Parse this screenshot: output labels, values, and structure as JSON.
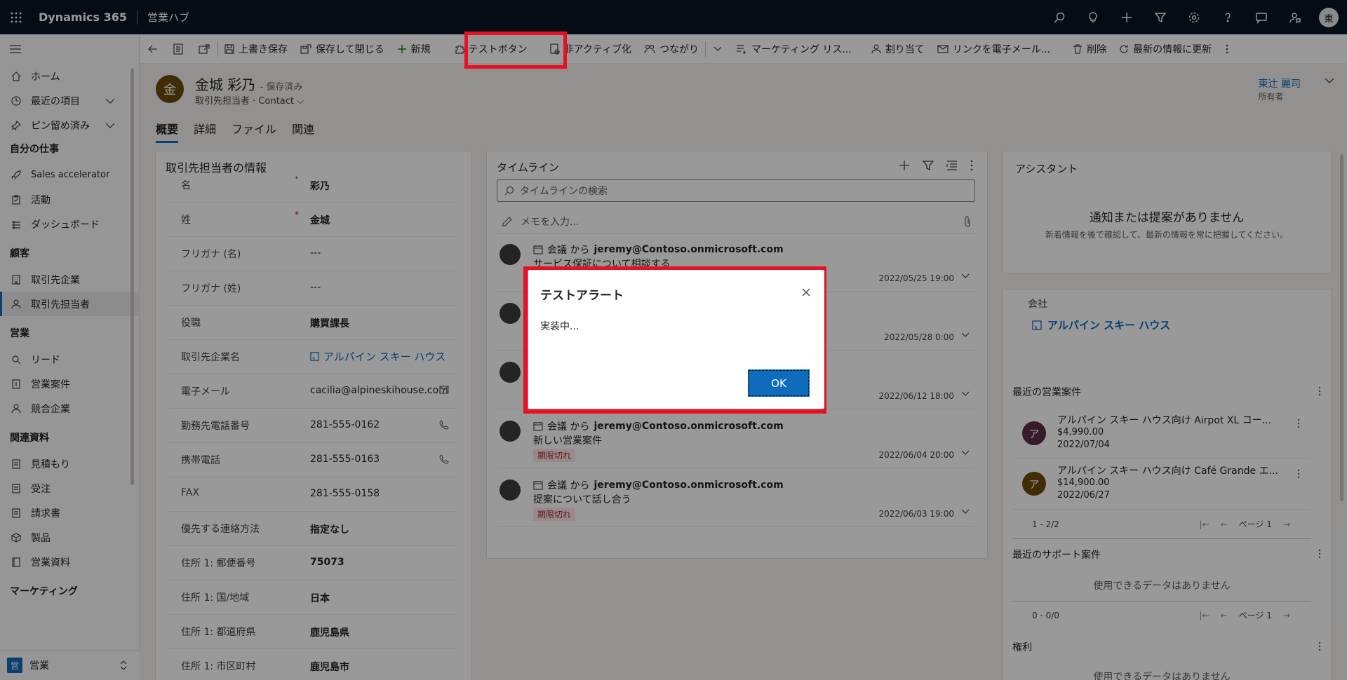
{
  "topbar": {
    "app_title": "Dynamics 365",
    "hub": "営業ハブ",
    "user_initial": "東"
  },
  "sidebar": {
    "items_top": [
      {
        "label": "ホーム",
        "icon": "home-icon"
      },
      {
        "label": "最近の項目",
        "icon": "clock-icon"
      },
      {
        "label": "ピン留め済み",
        "icon": "pin-icon"
      }
    ],
    "group_work": "自分の仕事",
    "items_work": [
      {
        "label": "Sales accelerator",
        "icon": "rocket-icon"
      },
      {
        "label": "活動",
        "icon": "clipboard-icon"
      },
      {
        "label": "ダッシュボード",
        "icon": "dashboard-icon"
      }
    ],
    "group_customer": "顧客",
    "items_customer": [
      {
        "label": "取引先企業",
        "icon": "building-icon"
      },
      {
        "label": "取引先担当者",
        "icon": "person-icon"
      }
    ],
    "group_sales": "営業",
    "items_sales": [
      {
        "label": "リード",
        "icon": "phone-person-icon"
      },
      {
        "label": "営業案件",
        "icon": "document-icon"
      },
      {
        "label": "競合企業",
        "icon": "person-icon"
      }
    ],
    "group_material": "関連資料",
    "items_material": [
      {
        "label": "見積もり",
        "icon": "document-icon"
      },
      {
        "label": "受注",
        "icon": "document-icon"
      },
      {
        "label": "請求書",
        "icon": "document-icon"
      },
      {
        "label": "製品",
        "icon": "box-icon"
      },
      {
        "label": "営業資料",
        "icon": "book-icon"
      }
    ],
    "group_marketing": "マーケティング",
    "area_badge": "営",
    "area_label": "営業"
  },
  "commandbar": {
    "save": "上書き保存",
    "save_close": "保存して閉じる",
    "new": "新規",
    "test_button": "テストボタン",
    "deactivate": "非アクティブ化",
    "connect": "つながり",
    "marketing_list": "マーケティング リス...",
    "assign": "割り当て",
    "email_link": "リンクを電子メール...",
    "delete": "削除",
    "refresh": "最新の情報に更新"
  },
  "record": {
    "avatar_initial": "金",
    "name": "金城 彩乃",
    "saved_status": "- 保存済み",
    "entity": "取引先担当者",
    "dot": "·",
    "form": "Contact",
    "owner_name": "東辻 麗司",
    "owner_label": "所有者"
  },
  "tabs": [
    "概要",
    "詳細",
    "ファイル",
    "関連"
  ],
  "contact_card": {
    "title": "取引先担当者の情報",
    "fields": [
      {
        "label": "名",
        "value": "彩乃"
      },
      {
        "label": "姓",
        "value": "金城"
      },
      {
        "label": "フリガナ (名)",
        "value": "---"
      },
      {
        "label": "フリガナ (姓)",
        "value": "---"
      },
      {
        "label": "役職",
        "value": "購買課長"
      },
      {
        "label": "取引先企業名",
        "value": "アルパイン スキー ハウス"
      },
      {
        "label": "電子メール",
        "value": "cacilia@alpineskihouse.com"
      },
      {
        "label": "勤務先電話番号",
        "value": "281-555-0162"
      },
      {
        "label": "携帯電話",
        "value": "281-555-0163"
      },
      {
        "label": "FAX",
        "value": "281-555-0158"
      },
      {
        "label": "優先する連絡方法",
        "value": "指定なし"
      },
      {
        "label": "住所 1: 郵便番号",
        "value": "75073"
      },
      {
        "label": "住所 1: 国/地域",
        "value": "日本"
      },
      {
        "label": "住所 1: 都道府県",
        "value": "鹿児島県"
      },
      {
        "label": "住所 1: 市区町村",
        "value": "鹿児島市"
      }
    ],
    "required_mark": "*"
  },
  "timeline": {
    "title": "タイムライン",
    "search_placeholder": "タイムラインの検索",
    "note_placeholder": "メモを入力...",
    "items": [
      {
        "prefix": "会議 から",
        "from": "jeremy@Contoso.onmicrosoft.com",
        "subject": "サービス保証について相談する",
        "tag": "",
        "date": "2022/05/25 19:00"
      },
      {
        "prefix": "",
        "from": "",
        "subject": "",
        "tag": "",
        "date": "2022/05/28 0:00"
      },
      {
        "prefix": "",
        "from": "",
        "subject": "",
        "tag": "",
        "date": "2022/06/12 18:00"
      },
      {
        "prefix": "会議 から",
        "from": "jeremy@Contoso.onmicrosoft.com",
        "subject": "新しい営業案件",
        "tag": "期限切れ",
        "date": "2022/06/04 20:00"
      },
      {
        "prefix": "会議 から",
        "from": "jeremy@Contoso.onmicrosoft.com",
        "subject": "提案について話し合う",
        "tag": "期限切れ",
        "date": "2022/06/03 19:00"
      }
    ]
  },
  "assistant": {
    "title": "アシスタント",
    "empty": "通知または提案がありません",
    "desc": "新着情報を後で確認して、最新の情報を常に把握してください。"
  },
  "company": {
    "label": "会社",
    "link": "アルパイン スキー ハウス",
    "opps_title": "最近の営業案件",
    "opps": [
      {
        "initial": "ア",
        "title": "アルパイン スキー ハウス向け Airpot XL コー...",
        "amount": "$4,990.00",
        "date": "2022/07/04",
        "color": "#5c2e46"
      },
      {
        "initial": "ア",
        "title": "アルパイン スキー ハウス向け Café Grande エ...",
        "amount": "$14,900.00",
        "date": "2022/06/27",
        "color": "#6b4c0a"
      }
    ],
    "opps_count": "1 - 2/2",
    "page": "ページ 1",
    "support_title": "最近のサポート案件",
    "no_data": "使用できるデータはありません",
    "support_count": "0 - 0/0",
    "rights_title": "権利"
  },
  "dialog": {
    "title": "テストアラート",
    "body": "実装中...",
    "ok": "OK"
  }
}
